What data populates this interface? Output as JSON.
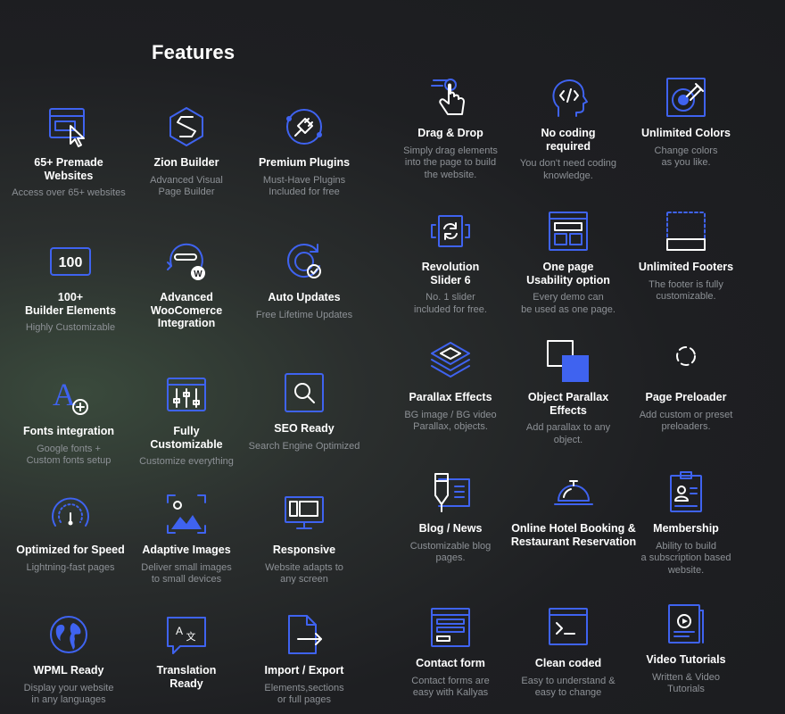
{
  "page": {
    "title": "Features"
  },
  "features": [
    {
      "title": "65+ Premade\nWebsites",
      "desc": "Access over 65+ websites",
      "icon": "browser-cursor-icon"
    },
    {
      "title": "Zion Builder",
      "desc": "Advanced Visual\nPage Builder",
      "icon": "zion-logo-icon"
    },
    {
      "title": "Premium Plugins",
      "desc": "Must-Have Plugins\nIncluded for free",
      "icon": "plug-icon"
    },
    {
      "title": "100+\nBuilder Elements",
      "desc": "Highly Customizable",
      "icon": "badge-100-icon",
      "badge": "100"
    },
    {
      "title": "Advanced\nWooComerce\nIntegration",
      "desc": "",
      "icon": "woocommerce-icon",
      "badge": "W"
    },
    {
      "title": "Auto Updates",
      "desc": "Free Lifetime Updates",
      "icon": "refresh-check-icon"
    },
    {
      "title": "Fonts integration",
      "desc": "Google fonts +\nCustom fonts setup",
      "icon": "font-plus-icon",
      "badge": "A"
    },
    {
      "title": "Fully\nCustomizable",
      "desc": "Customize everything",
      "icon": "sliders-icon"
    },
    {
      "title": "SEO Ready",
      "desc": "Search Engine Optimized",
      "icon": "magnifier-icon"
    },
    {
      "title": "Optimized for Speed",
      "desc": "Lightning-fast pages",
      "icon": "speedometer-icon"
    },
    {
      "title": "Adaptive Images",
      "desc": "Deliver small images\nto small devices",
      "icon": "image-crop-icon"
    },
    {
      "title": "Responsive",
      "desc": "Website adapts to\nany screen",
      "icon": "devices-icon"
    },
    {
      "title": "WPML Ready",
      "desc": "Display your website\nin any languages",
      "icon": "globe-icon"
    },
    {
      "title": "Translation\nReady",
      "desc": "",
      "icon": "translate-icon",
      "badge": "A",
      "badge2": "文"
    },
    {
      "title": "Import / Export",
      "desc": "Elements,sections\nor full pages",
      "icon": "file-export-icon"
    },
    {
      "title": "Drag & Drop",
      "desc": "Simply drag elements\ninto the page to build\nthe website.",
      "icon": "hand-tap-icon"
    },
    {
      "title": "No coding\nrequired",
      "desc": "You don't need coding\nknowledge.",
      "icon": "head-code-icon"
    },
    {
      "title": "Unlimited Colors",
      "desc": "Change colors\nas you like.",
      "icon": "color-picker-icon"
    },
    {
      "title": "Revolution\nSlider 6",
      "desc": "No. 1 slider\nincluded for free.",
      "icon": "slider-refresh-icon"
    },
    {
      "title": "One page\nUsability option",
      "desc": "Every demo can\nbe used as one page.",
      "icon": "one-page-layout-icon"
    },
    {
      "title": "Unlimited Footers",
      "desc": "The footer is fully\ncustomizable.",
      "icon": "footer-layout-icon"
    },
    {
      "title": "Parallax Effects",
      "desc": "BG image / BG video\nParallax, objects.",
      "icon": "layers-icon"
    },
    {
      "title": "Object Parallax\nEffects",
      "desc": "Add parallax to any\nobject.",
      "icon": "overlap-squares-icon"
    },
    {
      "title": "Page Preloader",
      "desc": "Add custom or preset\npreloaders.",
      "icon": "spinner-icon"
    },
    {
      "title": "Blog / News",
      "desc": "Customizable blog\npages.",
      "icon": "pen-paper-icon"
    },
    {
      "title": "Online Hotel Booking &\nRestaurant Reservation",
      "desc": "",
      "icon": "service-bell-icon"
    },
    {
      "title": "Membership",
      "desc": "Ability to build\na subscription based\nwebsite.",
      "icon": "member-card-icon"
    },
    {
      "title": "Contact form",
      "desc": "Contact forms are\neasy with Kallyas",
      "icon": "form-window-icon"
    },
    {
      "title": "Clean coded",
      "desc": "Easy to understand &\neasy to change",
      "icon": "terminal-icon"
    },
    {
      "title": "Video Tutorials",
      "desc": "Written & Video\nTutorials",
      "icon": "video-tutorial-icon"
    }
  ]
}
